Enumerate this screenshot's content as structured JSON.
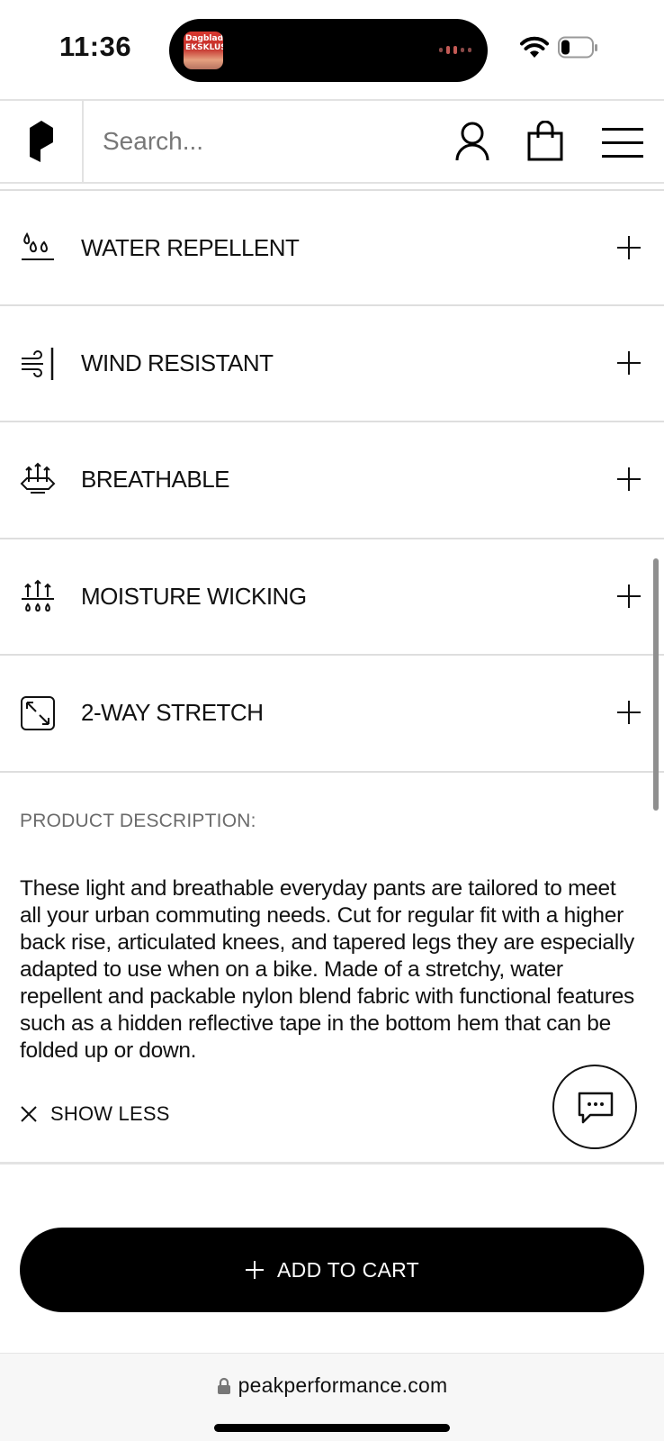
{
  "status_bar": {
    "time": "11:36",
    "island_app_text": "Dagbladet EKSKLUSIVT",
    "icons": [
      "wifi-icon",
      "battery-icon"
    ]
  },
  "header": {
    "logo": "peak-performance-logo-icon",
    "search_placeholder": "Search...",
    "icons": [
      "account-icon",
      "shopping-bag-icon",
      "menu-icon"
    ]
  },
  "features": [
    {
      "label": "WATER REPELLENT",
      "icon": "water-drops-icon"
    },
    {
      "label": "WIND RESISTANT",
      "icon": "wind-icon"
    },
    {
      "label": "BREATHABLE",
      "icon": "breathable-arrows-icon"
    },
    {
      "label": "MOISTURE WICKING",
      "icon": "moisture-wicking-icon"
    },
    {
      "label": "2-WAY STRETCH",
      "icon": "stretch-arrows-icon"
    }
  ],
  "description": {
    "title": "PRODUCT DESCRIPTION:",
    "text": "These light and breathable everyday pants are tailored to meet all your urban commuting needs. Cut for regular fit with a higher back rise, articulated knees, and tapered legs they are especially adapted to use when on a bike. Made of a stretchy, water repellent and packable nylon blend fabric with functional features such as a hidden reflective tape in the bottom hem that can be folded up or down.",
    "toggle_label": "SHOW LESS"
  },
  "chat": {
    "icon": "chat-icon"
  },
  "cart": {
    "button_label": "ADD TO CART"
  },
  "browser": {
    "url": "peakperformance.com"
  }
}
